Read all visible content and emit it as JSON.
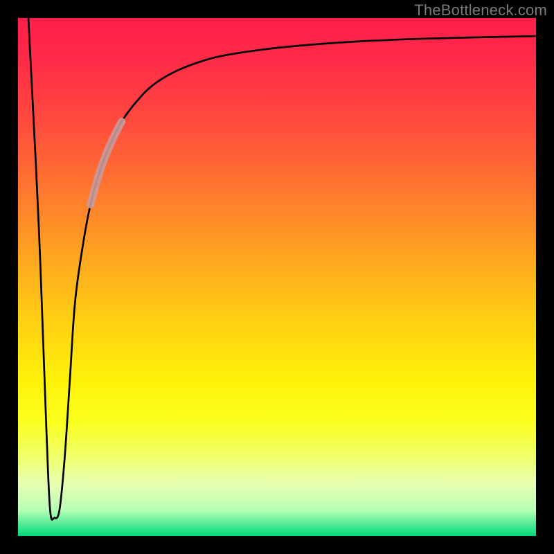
{
  "watermark": "TheBottleneck.com",
  "chart_data": {
    "type": "line",
    "title": "",
    "xlabel": "",
    "ylabel": "",
    "xlim": [
      0,
      100
    ],
    "ylim": [
      0,
      100
    ],
    "grid": false,
    "legend": false,
    "background_gradient": {
      "top": "#ff1d4c",
      "middle": "#fff20a",
      "bottom": "#00d87a"
    },
    "series": [
      {
        "name": "curve",
        "color": "#000000",
        "width": 2.7,
        "x": [
          2.0,
          4.0,
          5.5,
          6.2,
          7.0,
          8.0,
          9.0,
          10.0,
          11.0,
          12.5,
          14.0,
          16.0,
          18.0,
          20.0,
          23.0,
          26.0,
          30.0,
          35.0,
          40.0,
          48.0,
          56.0,
          66.0,
          78.0,
          90.0,
          100.0
        ],
        "y": [
          100.0,
          60.0,
          20.0,
          5.0,
          3.5,
          5.0,
          15.0,
          30.0,
          45.0,
          56.0,
          64.0,
          71.0,
          76.0,
          80.0,
          84.0,
          87.0,
          89.5,
          91.5,
          92.8,
          94.0,
          94.8,
          95.5,
          96.0,
          96.3,
          96.5
        ]
      }
    ],
    "highlight_segment": {
      "on_series": "curve",
      "x_start": 15.5,
      "x_end": 19.5,
      "color": "#c99a9a",
      "width": 11
    }
  }
}
